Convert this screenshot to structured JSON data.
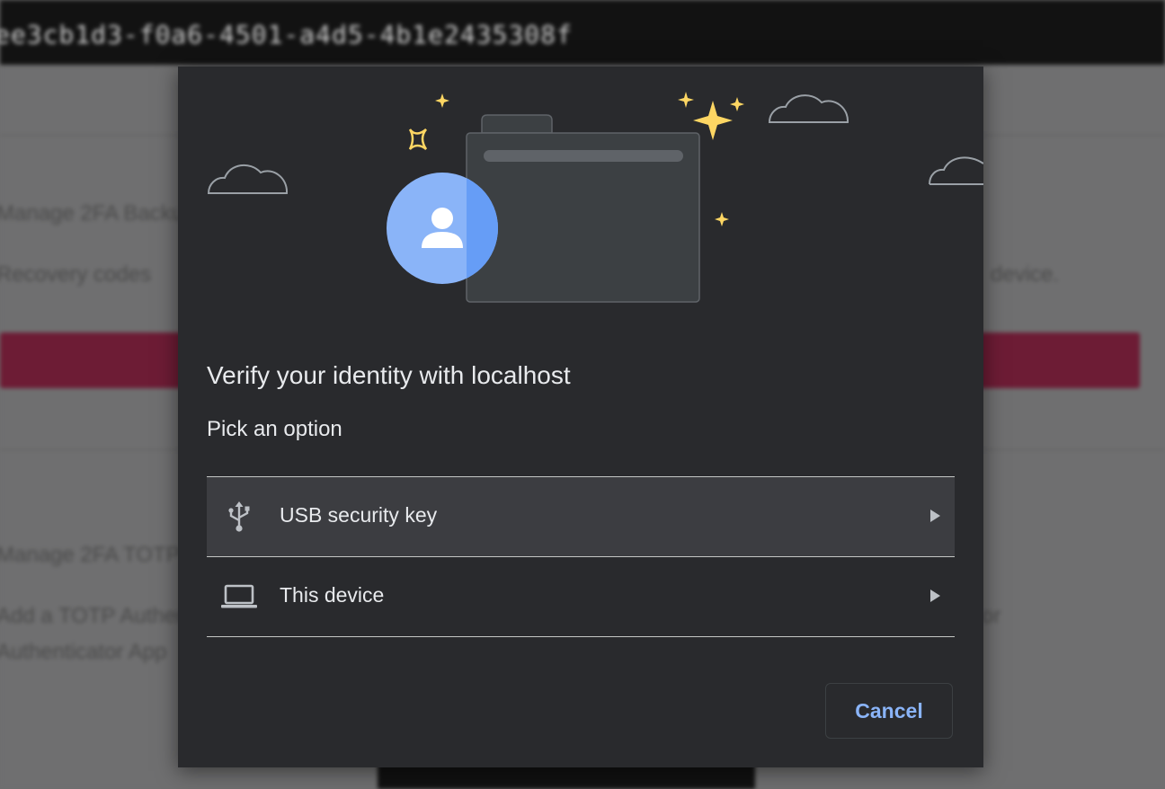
{
  "background": {
    "url_fragment": "ee3cb1d3-f0a6-4501-a4d5-4b1e2435308f",
    "text_manage_2fa_backup": "Manage 2FA Backup",
    "text_recovery_codes": "Recovery codes",
    "text_device_suffix": "device.",
    "text_manage_2fa_totp": "Manage 2FA TOTP",
    "text_add_totp": "Add a TOTP Authenticator",
    "text_authenticator_app": "Authenticator App",
    "text_or_suffix": "or"
  },
  "dialog": {
    "title": "Verify your identity with localhost",
    "subtitle": "Pick an option",
    "options": [
      {
        "label": "USB security key",
        "icon": "usb-icon",
        "hovered": true
      },
      {
        "label": "This device",
        "icon": "laptop-icon",
        "hovered": false
      }
    ],
    "cancel_label": "Cancel"
  },
  "colors": {
    "dialog_bg": "#292a2d",
    "accent": "#8ab4f8",
    "avatar_blue": "#8ab4f8",
    "avatar_blue_dark": "#669df6",
    "sparkle": "#fdd663",
    "text": "#e8eaed"
  }
}
